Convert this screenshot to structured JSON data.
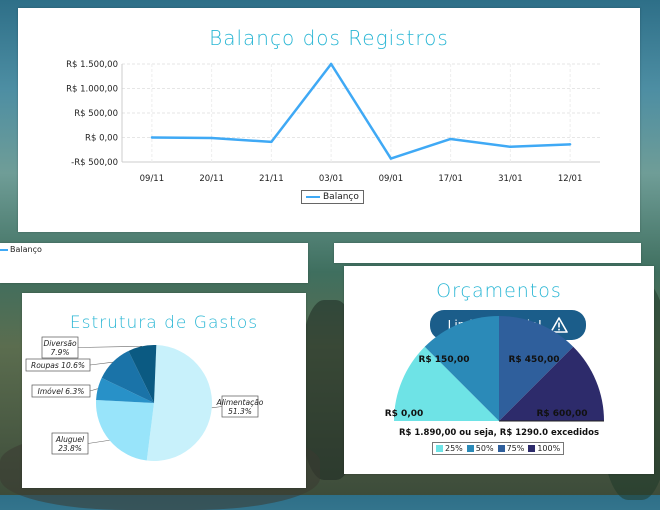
{
  "balance_card": {
    "title": "Balanço dos Registros",
    "legend": "Balanço",
    "line_color": "#3fa9f5"
  },
  "back_card_legend": "Balanço",
  "gastos_card": {
    "title": "Estrutura de Gastos"
  },
  "budget_card": {
    "title": "Orçamentos",
    "limit_label": "Limite atingido!",
    "summary": "R$ 1.890,00 ou seja, R$ 1290.0 excedidos",
    "legend": [
      {
        "label": "25%",
        "color": "#6ee3e6"
      },
      {
        "label": "50%",
        "color": "#2b8ab8"
      },
      {
        "label": "75%",
        "color": "#2f5f9c"
      },
      {
        "label": "100%",
        "color": "#2d2b6b"
      }
    ],
    "tick_labels": [
      "R$ 0,00",
      "R$ 150,00",
      "R$ 450,00",
      "R$ 600,00"
    ]
  },
  "chart_data": [
    {
      "type": "line",
      "title": "Balanço dos Registros",
      "x": [
        "09/11",
        "20/11",
        "21/11",
        "03/01",
        "09/01",
        "17/01",
        "31/01",
        "12/01"
      ],
      "series": [
        {
          "name": "Balanço",
          "values": [
            0,
            -10,
            -90,
            1500,
            -430,
            -30,
            -190,
            -140
          ]
        }
      ],
      "ylim": [
        -500,
        1500
      ],
      "yticks": [
        -500,
        0,
        500,
        1000,
        1500
      ],
      "ytick_labels": [
        "-R$ 500,00",
        "R$ 0,00",
        "R$ 500,00",
        "R$ 1.000,00",
        "R$ 1.500,00"
      ],
      "grid": true,
      "legend": "bottom"
    },
    {
      "type": "pie",
      "title": "Estrutura de Gastos",
      "labels": [
        "Alimentação",
        "Aluguel",
        "Imóvel",
        "Roupas",
        "Diversão"
      ],
      "values": [
        51.3,
        23.8,
        6.3,
        10.6,
        7.9
      ],
      "display_labels": [
        [
          "Alimentação",
          "51.3%"
        ],
        [
          "Aluguel",
          "23.8%"
        ],
        [
          "Imóvel 6.3%"
        ],
        [
          "Roupas 10.6%"
        ],
        [
          "Diversão",
          "7.9%"
        ]
      ],
      "colors": [
        "#c8f1fb",
        "#98e4fa",
        "#2891c8",
        "#1a73a8",
        "#0b5a82"
      ]
    }
  ]
}
